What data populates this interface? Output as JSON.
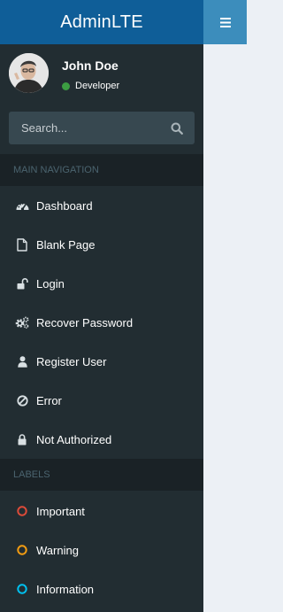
{
  "app": {
    "logo": "AdminLTE"
  },
  "user": {
    "name": "John Doe",
    "status": "Developer"
  },
  "search": {
    "placeholder": "Search..."
  },
  "nav": {
    "header": "MAIN NAVIGATION",
    "items": [
      {
        "label": "Dashboard",
        "icon": "dashboard-icon"
      },
      {
        "label": "Blank Page",
        "icon": "file-icon"
      },
      {
        "label": "Login",
        "icon": "unlock-icon"
      },
      {
        "label": "Recover Password",
        "icon": "gears-icon"
      },
      {
        "label": "Register User",
        "icon": "user-icon"
      },
      {
        "label": "Error",
        "icon": "ban-icon"
      },
      {
        "label": "Not Authorized",
        "icon": "lock-icon"
      }
    ]
  },
  "labels": {
    "header": "LABELS",
    "items": [
      {
        "label": "Important",
        "color": "#dd4b39"
      },
      {
        "label": "Warning",
        "color": "#f39c12"
      },
      {
        "label": "Information",
        "color": "#00c0ef"
      }
    ]
  },
  "colors": {
    "logo_bg": "#0f5e98",
    "navbar_bg": "#3c8dbc",
    "sidebar_bg": "#222d32",
    "status_online": "#3c9d42"
  }
}
